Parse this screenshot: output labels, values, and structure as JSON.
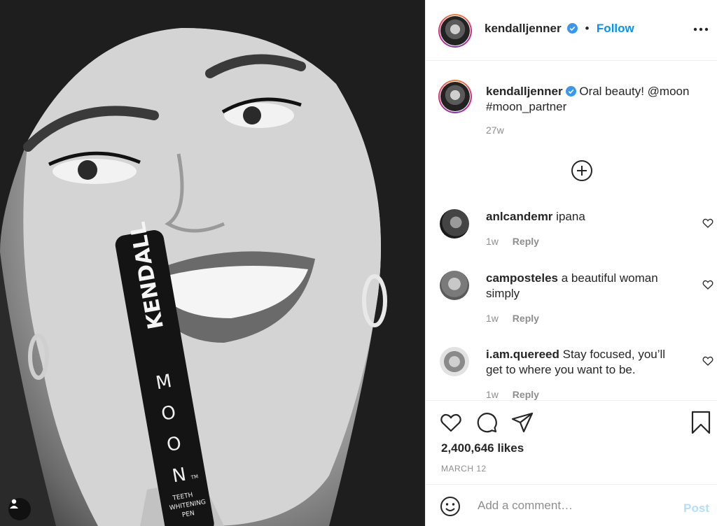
{
  "post": {
    "username": "kendalljenner",
    "follow_label": "Follow",
    "dot": "•"
  },
  "caption": {
    "username": "kendalljenner",
    "text_line1": "Oral beauty! @moon",
    "text_line2": "#moon_partner",
    "time": "27w"
  },
  "comments": [
    {
      "username": "anlcandemr",
      "text_line1": "ipana",
      "text_line2": "",
      "time": "1w",
      "reply_label": "Reply"
    },
    {
      "username": "camposteles",
      "text_line1": "a beautiful woman",
      "text_line2": "simply",
      "time": "1w",
      "reply_label": "Reply"
    },
    {
      "username": "i.am.quereed",
      "text_line1": "Stay focused, you’ll",
      "text_line2": "get to where you want to be.",
      "time": "1w",
      "reply_label": "Reply"
    }
  ],
  "photo": {
    "product_brand": "KENDALL",
    "product_name_letters": [
      "M",
      "O",
      "O",
      "N"
    ],
    "product_tm": "TM",
    "product_sub1": "TEETH",
    "product_sub2": "WHITENING",
    "product_sub3": "PEN"
  },
  "stats": {
    "likes": "2,400,646 likes",
    "date": "MARCH 12"
  },
  "add_comment": {
    "placeholder": "Add a comment…",
    "post_label": "Post"
  },
  "colors": {
    "accent": "#0095f6",
    "verified": "#3897f0",
    "post_disabled": "#b2dffc",
    "meta": "#8e8e8e"
  },
  "icons": [
    "more-options-icon",
    "verified-icon",
    "load-more-icon",
    "heart-icon",
    "comment-icon",
    "share-icon",
    "bookmark-icon",
    "emoji-icon",
    "tag-user-icon"
  ]
}
